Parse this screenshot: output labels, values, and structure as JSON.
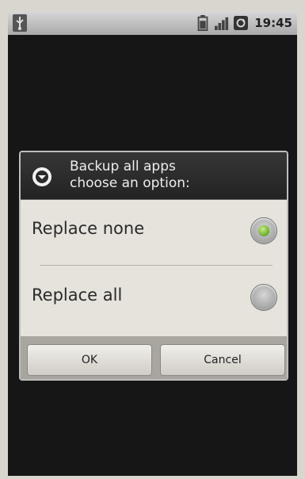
{
  "status_bar": {
    "time": "19:45",
    "icons": [
      "usb-icon",
      "battery-icon",
      "signal-icon",
      "sync-icon"
    ]
  },
  "dialog": {
    "title_line1": "Backup all apps",
    "title_line2": "choose an option:",
    "options": [
      {
        "label": "Replace none",
        "selected": true
      },
      {
        "label": "Replace all",
        "selected": false
      }
    ],
    "buttons": {
      "ok": "OK",
      "cancel": "Cancel"
    }
  }
}
